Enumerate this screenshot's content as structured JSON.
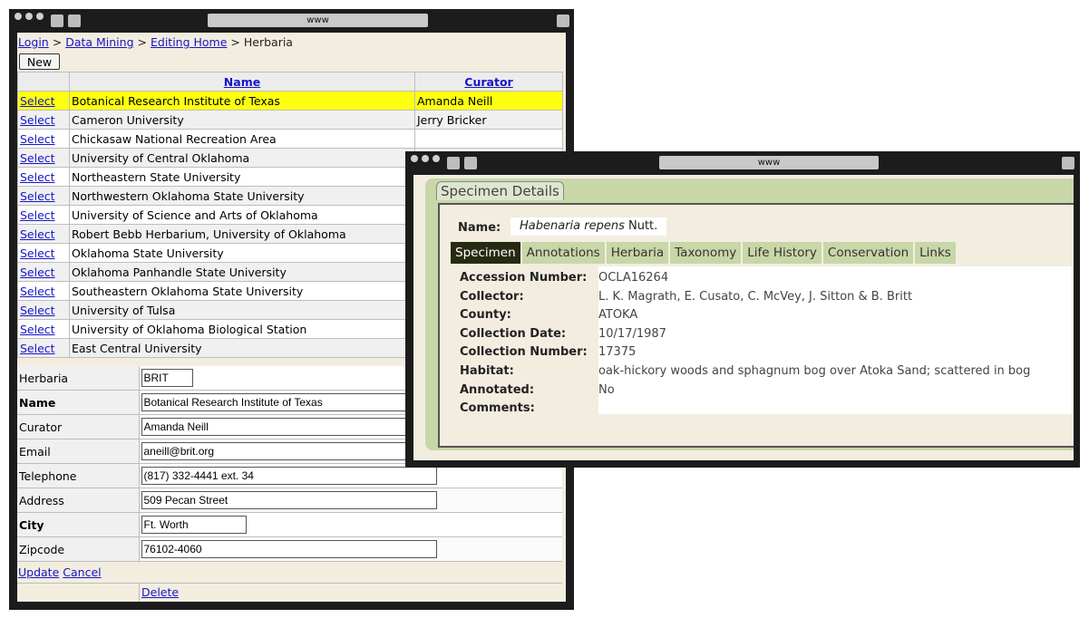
{
  "window1": {
    "url": "www",
    "breadcrumb": {
      "login": "Login",
      "sep": ">",
      "data_mining": "Data Mining",
      "editing_home": "Editing Home",
      "current": "Herbaria"
    },
    "new_label": "New",
    "table": {
      "headers": {
        "name": "Name",
        "curator": "Curator"
      },
      "select_label": "Select",
      "rows": [
        {
          "name": "Botanical Research Institute of Texas",
          "curator": "Amanda Neill"
        },
        {
          "name": "Cameron University",
          "curator": "Jerry Bricker"
        },
        {
          "name": "Chickasaw National Recreation Area",
          "curator": ""
        },
        {
          "name": "University of Central Oklahoma",
          "curator": ""
        },
        {
          "name": "Northeastern State University",
          "curator": ""
        },
        {
          "name": "Northwestern Oklahoma State University",
          "curator": ""
        },
        {
          "name": "University of Science and Arts of Oklahoma",
          "curator": ""
        },
        {
          "name": "Robert Bebb Herbarium, University of Oklahoma",
          "curator": ""
        },
        {
          "name": "Oklahoma State University",
          "curator": ""
        },
        {
          "name": "Oklahoma Panhandle State University",
          "curator": ""
        },
        {
          "name": "Southeastern Oklahoma State University",
          "curator": ""
        },
        {
          "name": "University of Tulsa",
          "curator": ""
        },
        {
          "name": "University of Oklahoma Biological Station",
          "curator": ""
        },
        {
          "name": "East Central University",
          "curator": ""
        }
      ]
    },
    "form": {
      "herbaria": {
        "label": "Herbaria",
        "value": "BRIT"
      },
      "name": {
        "label": "Name",
        "value": "Botanical Research Institute of Texas"
      },
      "curator": {
        "label": "Curator",
        "value": "Amanda Neill"
      },
      "email": {
        "label": "Email",
        "value": "aneill@brit.org"
      },
      "telephone": {
        "label": "Telephone",
        "value": "(817) 332-4441 ext. 34"
      },
      "address": {
        "label": "Address",
        "value": "509 Pecan Street"
      },
      "city": {
        "label": "City",
        "value": "Ft. Worth"
      },
      "zipcode": {
        "label": "Zipcode",
        "value": "76102-4060"
      }
    },
    "update_label": "Update",
    "cancel_label": "Cancel",
    "delete_label": "Delete"
  },
  "window2": {
    "url": "www",
    "panel_title": "Specimen Details",
    "name_label": "Name:",
    "name_species": "Habenaria repens",
    "name_author": "Nutt.",
    "tabs": [
      "Specimen",
      "Annotations",
      "Herbaria",
      "Taxonomy",
      "Life History",
      "Conservation",
      "Links"
    ],
    "active_tab": "Specimen",
    "details": [
      {
        "label": "Accession Number:",
        "value": "OCLA16264"
      },
      {
        "label": "Collector:",
        "value": "L. K. Magrath, E. Cusato, C. McVey, J. Sitton & B. Britt"
      },
      {
        "label": "County:",
        "value": "ATOKA"
      },
      {
        "label": "Collection Date:",
        "value": "10/17/1987"
      },
      {
        "label": "Collection Number:",
        "value": "17375"
      },
      {
        "label": "Habitat:",
        "value": "oak-hickory woods and sphagnum bog over Atoka Sand; scattered in bog"
      },
      {
        "label": "Annotated:",
        "value": "No"
      },
      {
        "label": "Comments:",
        "value": ""
      }
    ]
  }
}
